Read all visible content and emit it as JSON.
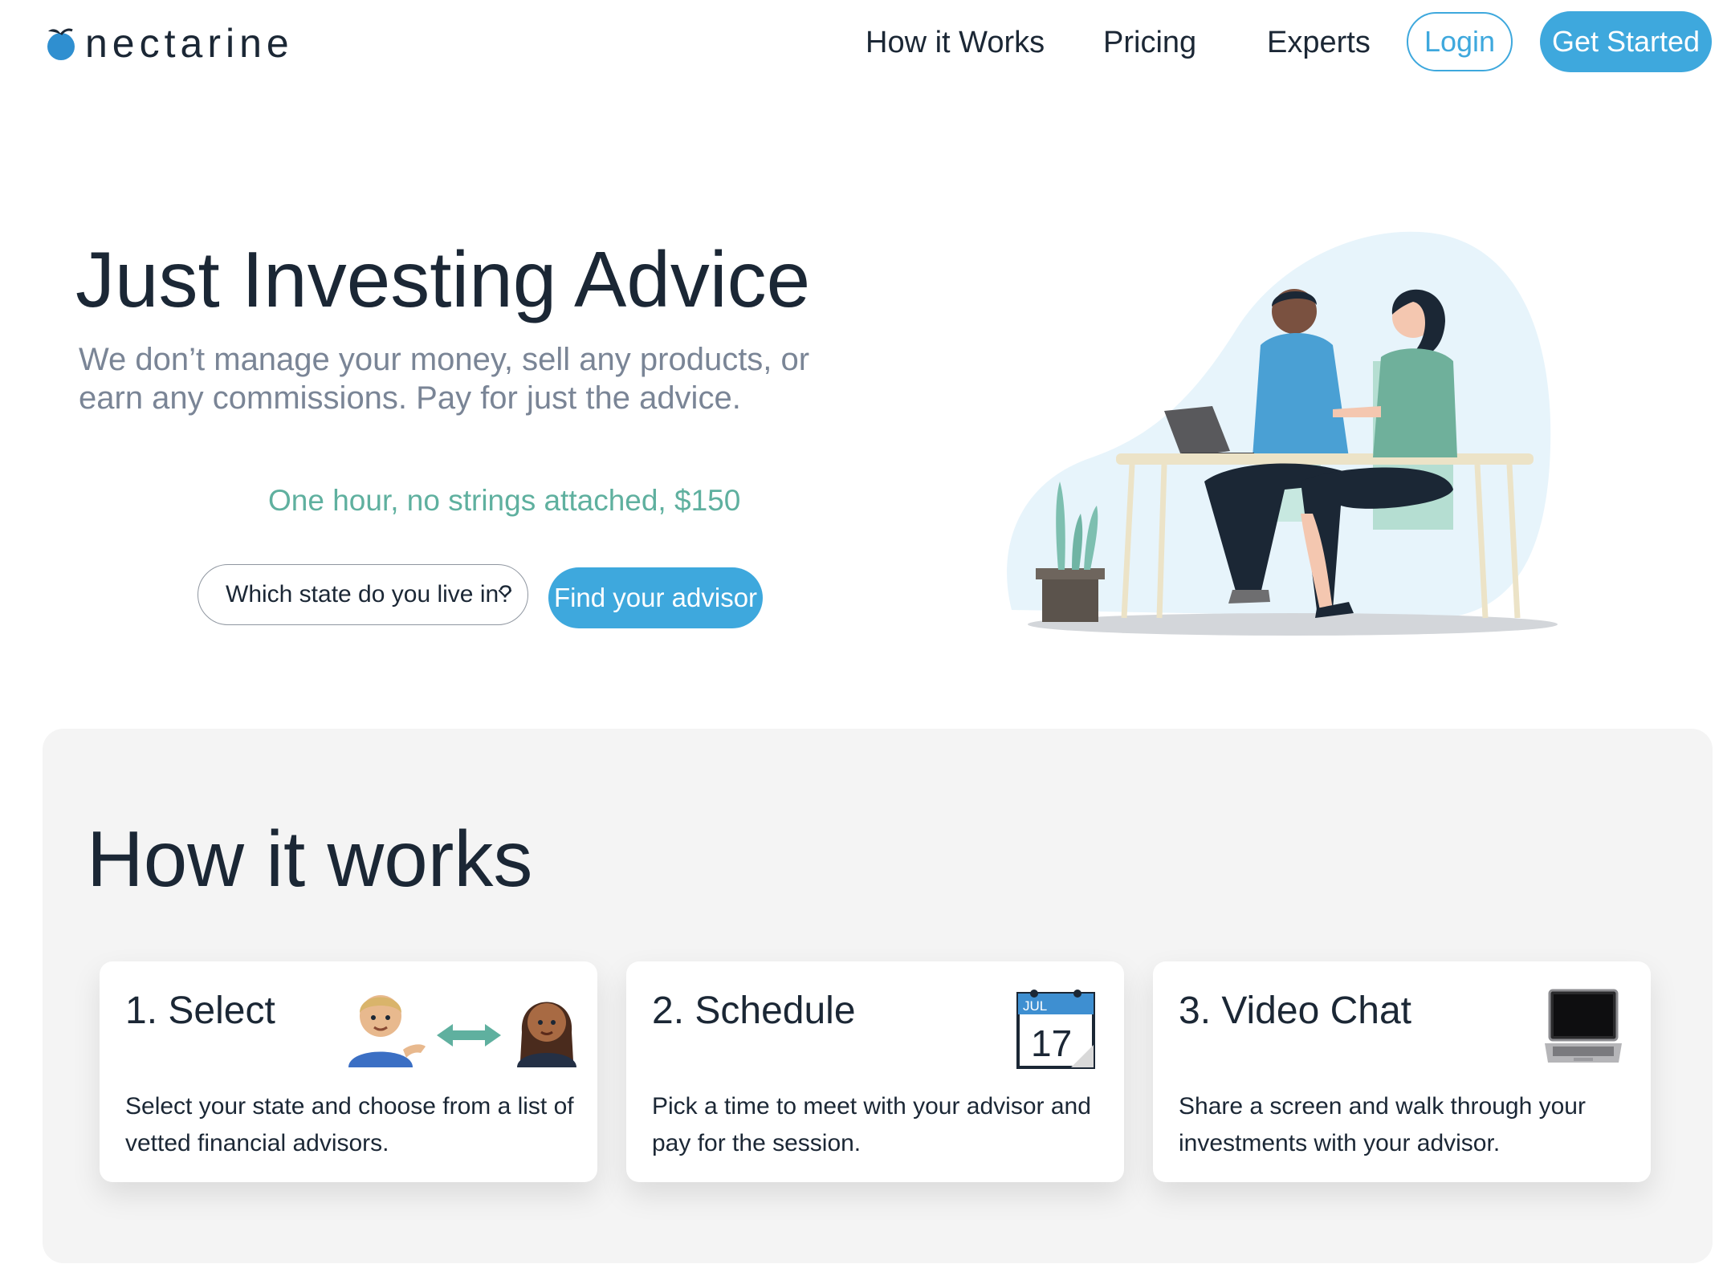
{
  "header": {
    "logo_text": "nectarine",
    "nav": [
      "How it Works",
      "Pricing",
      "Experts"
    ],
    "login_label": "Login",
    "get_started_label": "Get Started"
  },
  "hero": {
    "title": "Just Investing Advice",
    "subtitle": "We don’t manage your money, sell any products, or earn any commissions. Pay for just the advice.",
    "price_line": "One hour, no strings attached, $150",
    "state_select": {
      "selected": "Which state do you live in?"
    },
    "find_button_label": "Find your advisor"
  },
  "how_it_works": {
    "title": "How it works",
    "steps": [
      {
        "title": "1. Select",
        "description": "Select your state and choose from a list of vetted financial advisors.",
        "icon": "people-exchange-icon"
      },
      {
        "title": "2. Schedule",
        "description": "Pick a time to meet with your advisor and pay for the session.",
        "icon": "calendar-icon",
        "calendar_month": "JUL",
        "calendar_day": "17"
      },
      {
        "title": "3. Video Chat",
        "description": "Share a screen and walk through your investments with your advisor.",
        "icon": "laptop-icon"
      }
    ]
  },
  "colors": {
    "accent": "#3ea8dd",
    "price_text": "#5fb09f",
    "heading": "#1b2735",
    "muted_text": "#7a8596",
    "panel_bg": "#f4f4f4"
  }
}
